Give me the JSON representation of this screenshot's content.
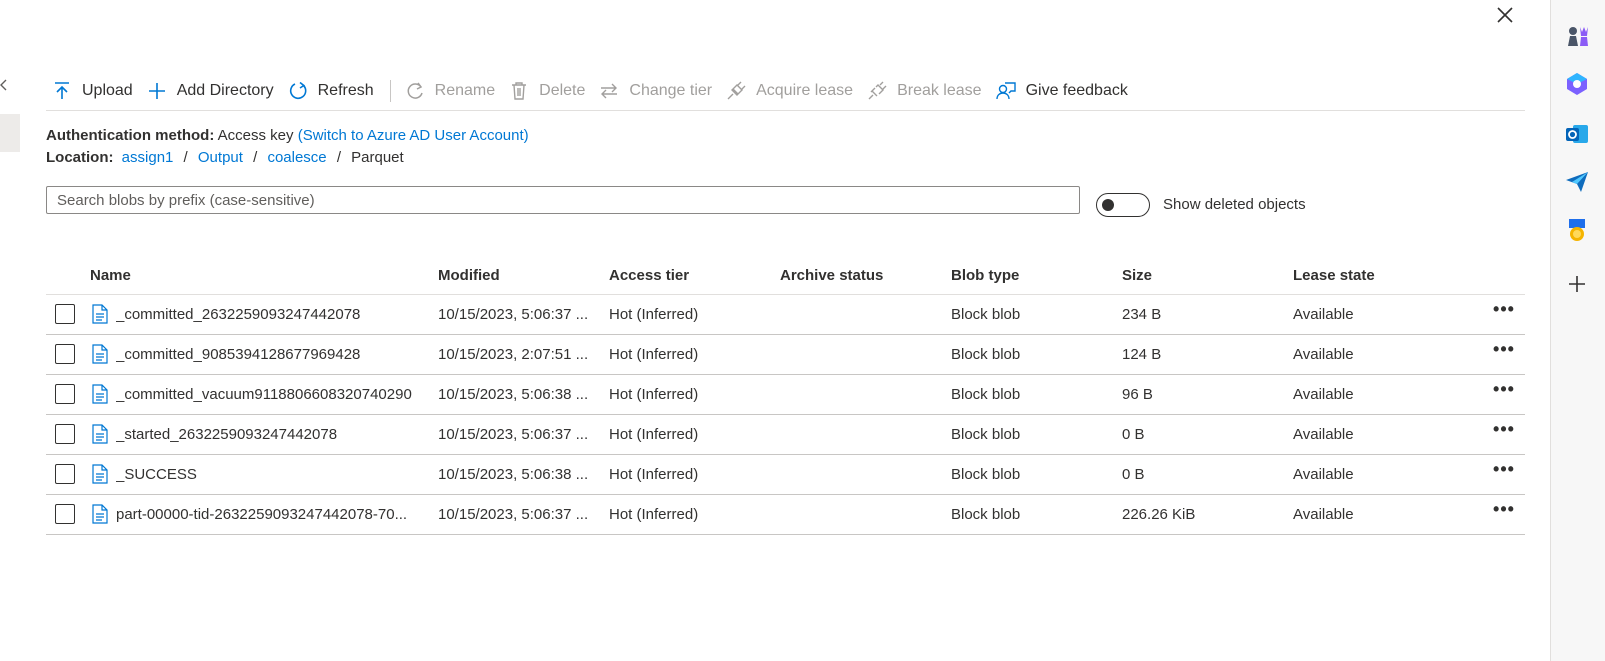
{
  "toolbar": {
    "upload": "Upload",
    "add_directory": "Add Directory",
    "refresh": "Refresh",
    "rename": "Rename",
    "delete": "Delete",
    "change_tier": "Change tier",
    "acquire_lease": "Acquire lease",
    "break_lease": "Break lease",
    "give_feedback": "Give feedback"
  },
  "auth": {
    "label": "Authentication method:",
    "value": "Access key",
    "switch_link": "(Switch to Azure AD User Account)"
  },
  "location": {
    "label": "Location:",
    "crumbs": [
      "assign1",
      "Output",
      "coalesce"
    ],
    "separator": "/",
    "current": "Parquet"
  },
  "search": {
    "placeholder": "Search blobs by prefix (case-sensitive)"
  },
  "toggle": {
    "label": "Show deleted objects",
    "on": false
  },
  "table": {
    "headers": {
      "name": "Name",
      "modified": "Modified",
      "access_tier": "Access tier",
      "archive_status": "Archive status",
      "blob_type": "Blob type",
      "size": "Size",
      "lease_state": "Lease state"
    },
    "more_glyph": "•••",
    "rows": [
      {
        "name": "_committed_2632259093247442078",
        "modified": "10/15/2023, 5:06:37 ...",
        "access_tier": "Hot (Inferred)",
        "archive_status": "",
        "blob_type": "Block blob",
        "size": "234 B",
        "lease_state": "Available"
      },
      {
        "name": "_committed_9085394128677969428",
        "modified": "10/15/2023, 2:07:51 ...",
        "access_tier": "Hot (Inferred)",
        "archive_status": "",
        "blob_type": "Block blob",
        "size": "124 B",
        "lease_state": "Available"
      },
      {
        "name": "_committed_vacuum9118806608320740290",
        "modified": "10/15/2023, 5:06:38 ...",
        "access_tier": "Hot (Inferred)",
        "archive_status": "",
        "blob_type": "Block blob",
        "size": "96 B",
        "lease_state": "Available"
      },
      {
        "name": "_started_2632259093247442078",
        "modified": "10/15/2023, 5:06:37 ...",
        "access_tier": "Hot (Inferred)",
        "archive_status": "",
        "blob_type": "Block blob",
        "size": "0 B",
        "lease_state": "Available"
      },
      {
        "name": "_SUCCESS",
        "modified": "10/15/2023, 5:06:38 ...",
        "access_tier": "Hot (Inferred)",
        "archive_status": "",
        "blob_type": "Block blob",
        "size": "0 B",
        "lease_state": "Available"
      },
      {
        "name": "part-00000-tid-2632259093247442078-70...",
        "modified": "10/15/2023, 5:06:37 ...",
        "access_tier": "Hot (Inferred)",
        "archive_status": "",
        "blob_type": "Block blob",
        "size": "226.26 KiB",
        "lease_state": "Available"
      }
    ]
  },
  "rail_icons": [
    "chess-icon",
    "copilot-icon",
    "outlook-icon",
    "send-icon",
    "rewards-icon",
    "add-icon"
  ],
  "colors": {
    "link": "#0078d4",
    "text": "#323130",
    "disabled": "#a19f9d",
    "file_icon": "#0078d4"
  }
}
